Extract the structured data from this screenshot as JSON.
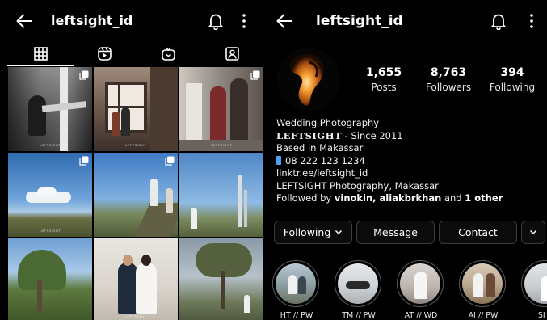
{
  "left_panel": {
    "header": {
      "back_icon": "arrow-left-icon",
      "username": "leftsight_id",
      "notification_icon": "bell-icon",
      "menu_icon": "more-vertical-icon"
    },
    "tabs": [
      {
        "icon": "grid-icon",
        "active": true
      },
      {
        "icon": "reels-icon",
        "active": false
      },
      {
        "icon": "igtv-icon",
        "active": false
      },
      {
        "icon": "tagged-icon",
        "active": false
      }
    ],
    "grid_posts": [
      {
        "watermark": "LEFTSIGHT",
        "multi": true
      },
      {
        "watermark": "LEFTSIGHT",
        "multi": false
      },
      {
        "watermark": "LEFTSIGHT",
        "multi": true
      },
      {
        "watermark": "LEFTSIGHT",
        "multi": true
      },
      {
        "watermark": "",
        "multi": true
      },
      {
        "watermark": "",
        "multi": false
      },
      {
        "watermark": "",
        "multi": false
      },
      {
        "watermark": "LEFTSIGHT",
        "multi": false
      },
      {
        "watermark": "",
        "multi": false
      }
    ]
  },
  "right_panel": {
    "header": {
      "back_icon": "arrow-left-icon",
      "username": "leftsight_id",
      "notification_icon": "bell-icon",
      "menu_icon": "more-vertical-icon"
    },
    "stats": {
      "posts": {
        "value": "1,655",
        "label": "Posts"
      },
      "followers": {
        "value": "8,763",
        "label": "Followers"
      },
      "following": {
        "value": "394",
        "label": "Following"
      }
    },
    "bio": {
      "category": "Wedding Photography",
      "brand": "LEFTSIGHT",
      "since": " - Since 2011",
      "location": "Based in Makassar",
      "phone_icon": "phone-icon",
      "phone": "08 222 123 1234",
      "link": "linktr.ee/leftsight_id",
      "address": "LEFTSIGHT Photography, Makassar",
      "followed_by_prefix": "Followed by ",
      "followed_by_users": "vinokin, aliakbrkhan",
      "followed_by_and": " and ",
      "followed_by_other": "1 other"
    },
    "buttons": {
      "following": "Following",
      "message": "Message",
      "contact": "Contact",
      "expand_icon": "chevron-down-icon"
    },
    "highlights": [
      {
        "label": "HT // PW"
      },
      {
        "label": "TM // PW"
      },
      {
        "label": "AT // WD"
      },
      {
        "label": "AI // PW"
      },
      {
        "label": "SI //"
      }
    ]
  },
  "colors": {
    "background": "#000000",
    "text": "#ffffff",
    "button_border": "#3c3c3c",
    "phone_icon": "#4aa3f0"
  }
}
